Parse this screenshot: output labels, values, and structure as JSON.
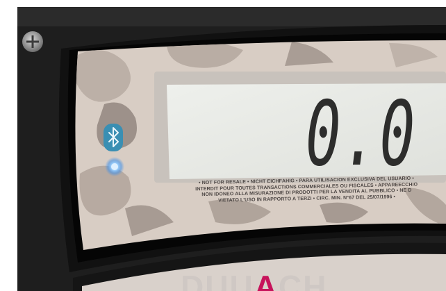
{
  "display": {
    "reading": "0.0"
  },
  "disclaimer": {
    "lines": [
      "• NOT FOR RESALE • NICHT EICHFÄHIG • PARA UTILISACION EXCLUSIVA DEL USUARIO •",
      "INTERDIT POUR TOUTES TRANSACTIONS COMMERCIALES OU FISCALES • APPAREECCHIO",
      "NON IDONEO ALLA MISURAZIONE DI PRODOTTI PER LA VENDITA AL PUBBLICO • NE D",
      "VIETATO L'USO IN RAPPORTO A TERZI • CIRC. MIN. N°67 DEL 25/07/1996 •"
    ]
  },
  "brand": {
    "text_start": "DUU",
    "text_accent": "A",
    "text_end": "CH"
  },
  "icons": {
    "bluetooth": "bluetooth-icon",
    "status_led": "status-led-icon",
    "screw": "screw-icon"
  },
  "colors": {
    "lcd_background": "#e4e5e1",
    "lcd_segments": "#2d2d2c",
    "bluetooth_badge": "#3a8fb3",
    "led_glow": "#6fb8ff",
    "bezel": "#151515",
    "brand_accent": "#c7135b"
  }
}
